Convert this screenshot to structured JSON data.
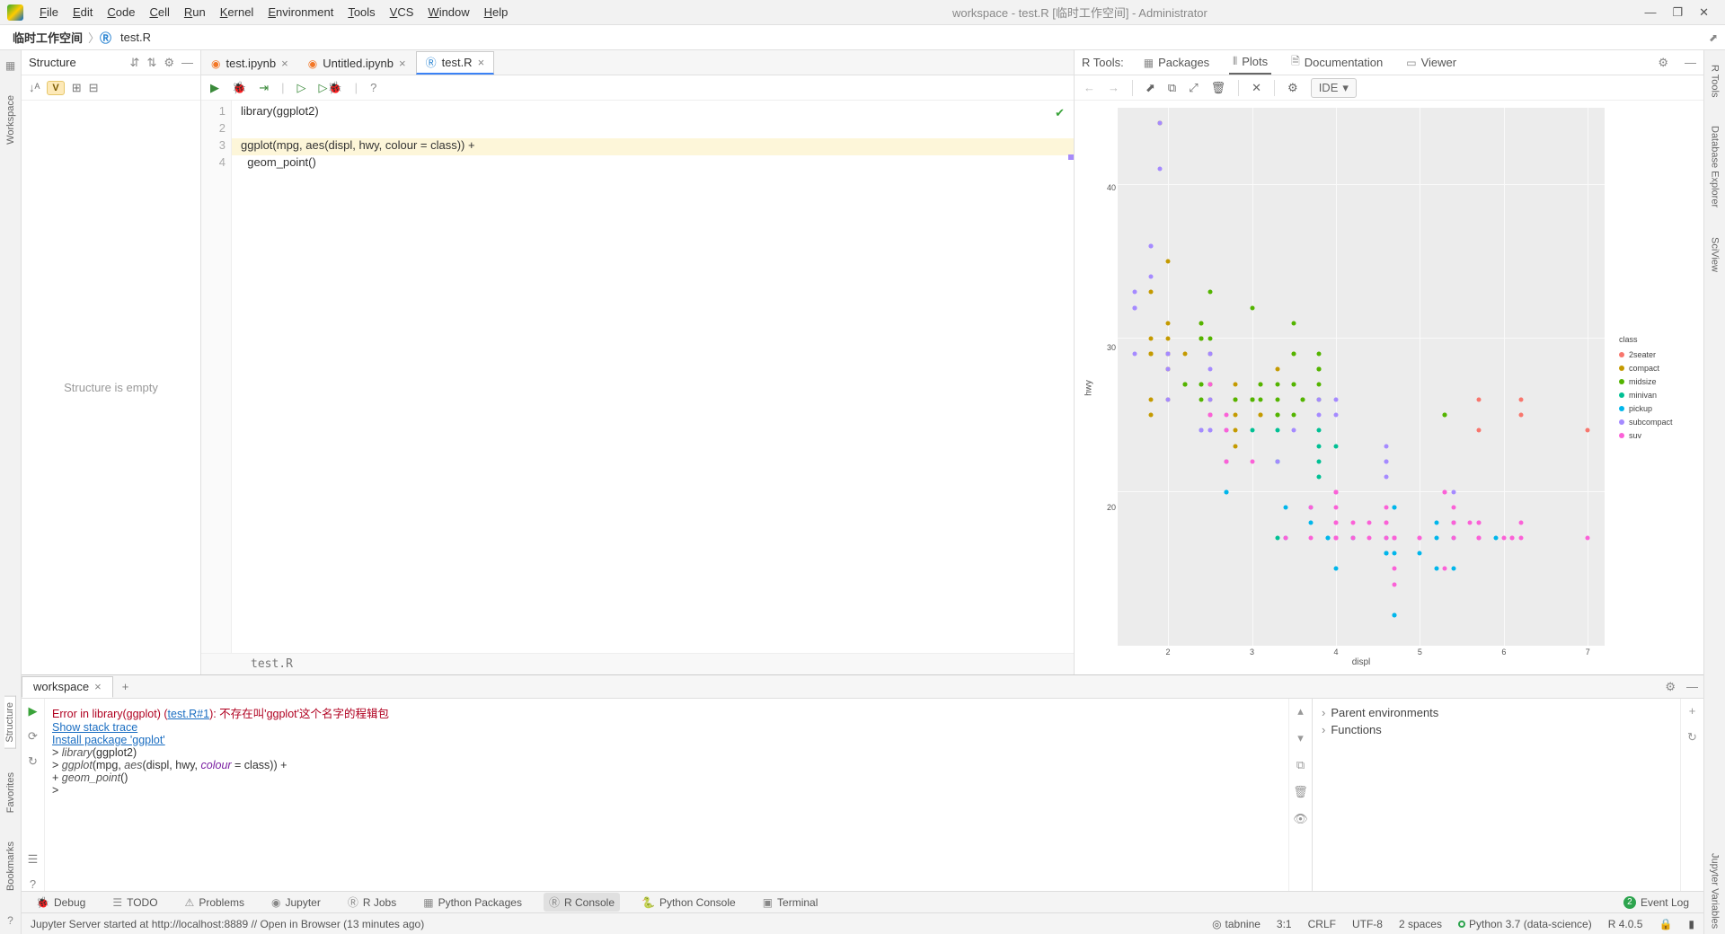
{
  "menubar": {
    "items": [
      "File",
      "Edit",
      "Code",
      "Cell",
      "Run",
      "Kernel",
      "Environment",
      "Tools",
      "VCS",
      "Window",
      "Help"
    ],
    "title": "workspace - test.R [临时工作空间] - Administrator"
  },
  "breadcrumb": {
    "root": "临时工作空间",
    "file": "test.R"
  },
  "left_rail": [
    "Workspace",
    "Structure",
    "Favorites",
    "Bookmarks"
  ],
  "right_rail": [
    "R Tools",
    "Database Explorer",
    "SciView",
    "Jupyter Variables"
  ],
  "structure": {
    "title": "Structure",
    "empty_text": "Structure is empty",
    "v_badge": "V"
  },
  "editor": {
    "tabs": [
      {
        "name": "test.ipynb",
        "active": false
      },
      {
        "name": "Untitled.ipynb",
        "active": false
      },
      {
        "name": "test.R",
        "active": true
      }
    ],
    "lines": [
      {
        "n": "1",
        "text": "library(ggplot2)",
        "hl": false
      },
      {
        "n": "2",
        "text": "",
        "hl": false
      },
      {
        "n": "3",
        "text": "ggplot(mpg, aes(displ, hwy, colour = class)) +",
        "hl": true
      },
      {
        "n": "4",
        "text": "  geom_point()",
        "hl": false
      }
    ],
    "status_file": "test.R"
  },
  "rtools": {
    "label": "R Tools:",
    "tabs": [
      "Packages",
      "Plots",
      "Documentation",
      "Viewer"
    ],
    "active_tab": "Plots",
    "ide_label": "IDE"
  },
  "chart_data": {
    "type": "scatter",
    "xlabel": "displ",
    "ylabel": "hwy",
    "xlim": [
      1.4,
      7.2
    ],
    "ylim": [
      10,
      45
    ],
    "x_ticks": [
      2,
      3,
      4,
      5,
      6,
      7
    ],
    "y_ticks": [
      20,
      30,
      40
    ],
    "legend_title": "class",
    "series": [
      {
        "name": "2seater",
        "color": "#F8766D",
        "points": [
          [
            5.7,
            26
          ],
          [
            5.7,
            24
          ],
          [
            6.2,
            26
          ],
          [
            6.2,
            25
          ],
          [
            7.0,
            24
          ]
        ]
      },
      {
        "name": "compact",
        "color": "#C49A00",
        "points": [
          [
            1.8,
            29
          ],
          [
            1.8,
            29
          ],
          [
            2.0,
            31
          ],
          [
            2.0,
            30
          ],
          [
            2.8,
            26
          ],
          [
            2.8,
            26
          ],
          [
            3.1,
            27
          ],
          [
            1.8,
            26
          ],
          [
            1.8,
            25
          ],
          [
            2.0,
            28
          ],
          [
            2.0,
            29
          ],
          [
            2.8,
            27
          ],
          [
            2.8,
            25
          ],
          [
            3.1,
            25
          ],
          [
            3.1,
            25
          ],
          [
            2.4,
            30
          ],
          [
            2.4,
            30
          ],
          [
            2.5,
            26
          ],
          [
            2.5,
            27
          ],
          [
            3.5,
            29
          ],
          [
            2.2,
            27
          ],
          [
            2.2,
            29
          ],
          [
            2.4,
            31
          ],
          [
            2.4,
            30
          ],
          [
            3.0,
            26
          ],
          [
            3.3,
            28
          ],
          [
            1.8,
            29
          ],
          [
            1.8,
            29
          ],
          [
            1.8,
            29
          ],
          [
            2.0,
            28
          ],
          [
            2.0,
            29
          ],
          [
            1.9,
            44
          ],
          [
            2.0,
            29
          ],
          [
            2.0,
            26
          ],
          [
            2.0,
            29
          ],
          [
            2.0,
            29
          ],
          [
            2.5,
            29
          ],
          [
            2.5,
            29
          ],
          [
            2.8,
            23
          ],
          [
            2.8,
            24
          ],
          [
            1.9,
            44
          ],
          [
            1.8,
            30
          ],
          [
            1.8,
            33
          ],
          [
            2.0,
            35
          ]
        ]
      },
      {
        "name": "midsize",
        "color": "#53B400",
        "points": [
          [
            2.4,
            27
          ],
          [
            2.4,
            30
          ],
          [
            3.1,
            26
          ],
          [
            3.5,
            29
          ],
          [
            3.6,
            26
          ],
          [
            2.4,
            26
          ],
          [
            2.4,
            27
          ],
          [
            2.5,
            30
          ],
          [
            2.5,
            33
          ],
          [
            3.3,
            25
          ],
          [
            3.3,
            25
          ],
          [
            3.3,
            26
          ],
          [
            3.8,
            27
          ],
          [
            3.8,
            28
          ],
          [
            3.8,
            29
          ],
          [
            5.3,
            25
          ],
          [
            2.2,
            27
          ],
          [
            2.2,
            27
          ],
          [
            2.4,
            30
          ],
          [
            2.4,
            31
          ],
          [
            3.0,
            26
          ],
          [
            3.0,
            26
          ],
          [
            3.5,
            27
          ],
          [
            3.1,
            27
          ],
          [
            3.8,
            26
          ],
          [
            3.8,
            28
          ],
          [
            3.8,
            28
          ],
          [
            5.3,
            25
          ],
          [
            2.5,
            27
          ],
          [
            2.5,
            25
          ],
          [
            3.5,
            25
          ],
          [
            3.0,
            26
          ],
          [
            3.0,
            32
          ],
          [
            3.5,
            27
          ],
          [
            3.5,
            31
          ],
          [
            3.0,
            26
          ],
          [
            3.3,
            27
          ],
          [
            2.8,
            26
          ],
          [
            3.6,
            26
          ]
        ]
      },
      {
        "name": "minivan",
        "color": "#00C094",
        "points": [
          [
            2.4,
            24
          ],
          [
            3.0,
            24
          ],
          [
            3.3,
            22
          ],
          [
            3.3,
            22
          ],
          [
            3.3,
            24
          ],
          [
            3.8,
            24
          ],
          [
            3.8,
            21
          ],
          [
            3.3,
            17
          ],
          [
            3.8,
            23
          ],
          [
            4.0,
            23
          ],
          [
            3.8,
            22
          ]
        ]
      },
      {
        "name": "pickup",
        "color": "#00B6EB",
        "points": [
          [
            3.7,
            19
          ],
          [
            3.7,
            18
          ],
          [
            3.9,
            17
          ],
          [
            3.9,
            17
          ],
          [
            4.7,
            19
          ],
          [
            4.7,
            19
          ],
          [
            4.7,
            12
          ],
          [
            5.2,
            17
          ],
          [
            5.2,
            15
          ],
          [
            5.9,
            17
          ],
          [
            4.7,
            17
          ],
          [
            4.7,
            16
          ],
          [
            4.7,
            12
          ],
          [
            5.2,
            18
          ],
          [
            4.7,
            17
          ],
          [
            4.2,
            17
          ],
          [
            4.2,
            17
          ],
          [
            4.6,
            16
          ],
          [
            4.6,
            16
          ],
          [
            4.6,
            17
          ],
          [
            5.4,
            17
          ],
          [
            5.4,
            15
          ],
          [
            2.7,
            20
          ],
          [
            2.7,
            20
          ],
          [
            2.7,
            22
          ],
          [
            3.4,
            17
          ],
          [
            3.4,
            19
          ],
          [
            4.0,
            20
          ],
          [
            4.0,
            17
          ],
          [
            4.0,
            15
          ],
          [
            4.6,
            16
          ],
          [
            5.0,
            16
          ],
          [
            5.4,
            18
          ]
        ]
      },
      {
        "name": "subcompact",
        "color": "#A58AFF",
        "points": [
          [
            3.8,
            26
          ],
          [
            3.8,
            25
          ],
          [
            4.0,
            26
          ],
          [
            4.0,
            25
          ],
          [
            4.6,
            21
          ],
          [
            4.6,
            22
          ],
          [
            4.6,
            23
          ],
          [
            4.6,
            22
          ],
          [
            5.4,
            20
          ],
          [
            1.6,
            33
          ],
          [
            1.6,
            32
          ],
          [
            1.6,
            32
          ],
          [
            1.6,
            29
          ],
          [
            1.6,
            32
          ],
          [
            1.8,
            34
          ],
          [
            1.8,
            36
          ],
          [
            1.8,
            36
          ],
          [
            2.0,
            29
          ],
          [
            2.4,
            24
          ],
          [
            2.4,
            24
          ],
          [
            2.5,
            24
          ],
          [
            2.5,
            24
          ],
          [
            3.5,
            24
          ],
          [
            3.3,
            22
          ],
          [
            2.5,
            29
          ],
          [
            2.5,
            26
          ],
          [
            1.9,
            41
          ],
          [
            1.9,
            44
          ],
          [
            2.0,
            29
          ],
          [
            2.0,
            26
          ],
          [
            2.0,
            28
          ],
          [
            2.5,
            28
          ],
          [
            2.5,
            29
          ],
          [
            2.7,
            24
          ],
          [
            2.7,
            24
          ]
        ]
      },
      {
        "name": "suv",
        "color": "#FB61D7",
        "points": [
          [
            5.3,
            20
          ],
          [
            5.3,
            15
          ],
          [
            5.3,
            20
          ],
          [
            5.7,
            17
          ],
          [
            6.0,
            17
          ],
          [
            5.7,
            18
          ],
          [
            5.7,
            17
          ],
          [
            6.2,
            18
          ],
          [
            6.2,
            17
          ],
          [
            7.0,
            17
          ],
          [
            6.1,
            17
          ],
          [
            3.7,
            19
          ],
          [
            4.7,
            14
          ],
          [
            4.0,
            17
          ],
          [
            4.0,
            17
          ],
          [
            4.0,
            19
          ],
          [
            4.0,
            18
          ],
          [
            4.6,
            17
          ],
          [
            5.0,
            17
          ],
          [
            4.2,
            17
          ],
          [
            4.4,
            17
          ],
          [
            4.6,
            18
          ],
          [
            5.4,
            18
          ],
          [
            5.4,
            18
          ],
          [
            5.4,
            17
          ],
          [
            4.0,
            17
          ],
          [
            4.0,
            20
          ],
          [
            4.6,
            19
          ],
          [
            5.0,
            17
          ],
          [
            3.0,
            22
          ],
          [
            3.7,
            17
          ],
          [
            4.0,
            17
          ],
          [
            4.7,
            17
          ],
          [
            4.7,
            15
          ],
          [
            4.7,
            17
          ],
          [
            5.7,
            18
          ],
          [
            6.1,
            17
          ],
          [
            4.0,
            17
          ],
          [
            4.2,
            18
          ],
          [
            4.4,
            18
          ],
          [
            4.6,
            18
          ],
          [
            5.4,
            19
          ],
          [
            2.5,
            25
          ],
          [
            2.5,
            27
          ],
          [
            2.5,
            25
          ],
          [
            2.5,
            25
          ],
          [
            2.7,
            25
          ],
          [
            2.7,
            24
          ],
          [
            3.4,
            17
          ],
          [
            4.0,
            20
          ],
          [
            4.7,
            17
          ],
          [
            5.7,
            17
          ],
          [
            2.7,
            22
          ],
          [
            2.7,
            22
          ],
          [
            4.0,
            18
          ],
          [
            4.0,
            20
          ],
          [
            4.0,
            17
          ],
          [
            4.7,
            17
          ],
          [
            5.6,
            18
          ]
        ]
      }
    ]
  },
  "console": {
    "tab_name": "workspace",
    "error_prefix": "Error in library(ggplot) (",
    "error_link": "test.R#1",
    "error_suffix": "): 不存在叫'ggplot'这个名字的程辑包",
    "show_stack": "Show stack trace",
    "install_pkg": "Install package 'ggplot'",
    "lines": [
      "> library(ggplot2)",
      "> ggplot(mpg, aes(displ, hwy, colour = class)) +",
      "+   geom_point()",
      "> "
    ]
  },
  "env": {
    "items": [
      "Parent environments",
      "Functions"
    ]
  },
  "bottom_tabs": {
    "items": [
      "Debug",
      "TODO",
      "Problems",
      "Jupyter",
      "R Jobs",
      "Python Packages",
      "R Console",
      "Python Console",
      "Terminal"
    ],
    "active": "R Console",
    "event_log": "Event Log",
    "event_count": "2"
  },
  "status": {
    "msg": "Jupyter Server started at http://localhost:8889 // Open in Browser (13 minutes ago)",
    "tabnine": "tabnine",
    "pos": "3:1",
    "eol": "CRLF",
    "enc": "UTF-8",
    "indent": "2 spaces",
    "python": "Python 3.7 (data-science)",
    "r": "R 4.0.5"
  }
}
